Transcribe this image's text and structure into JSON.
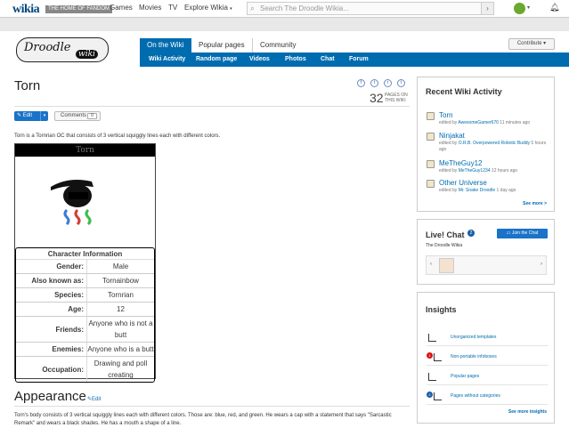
{
  "global": {
    "logo": "wikia",
    "tagline": "THE HOME OF FANDOM",
    "nav": [
      "Games",
      "Movies",
      "TV",
      "Explore Wikia"
    ],
    "search_placeholder": "Search The Droodle Wikia...",
    "avatar_color": "#6aa82e"
  },
  "wiki": {
    "wordmark_main": "Droodle",
    "wordmark_sub": "wiki",
    "tabs": [
      "On the Wiki",
      "Popular pages",
      "Community"
    ],
    "subnav": [
      "Wiki Activity",
      "Random page",
      "Videos",
      "Photos",
      "Chat",
      "Forum"
    ],
    "contribute": "Contribute",
    "accent": "#006cb0"
  },
  "article": {
    "title": "Torn",
    "social": [
      "f",
      "t",
      "r",
      "t"
    ],
    "pages_count": "32",
    "pages_label": "PAGES ON THIS WIKI",
    "edit_label": "Edit",
    "comments_label": "Comments",
    "comments_count": "0",
    "intro": "Torn is a Tornrian OC that consists of 3 vertical squiggly lines each with different colors.",
    "section_title": "Appearance",
    "section_edit": "Edit",
    "section_para": "Torn's body consists of 3 vertical squiggly lines each with different colors. Those are: blue, red, and green. He wears a cap with a statement that says \"Sarcastic Remark\" and wears a black shades. He has a mouth a shape of a line."
  },
  "infobox": {
    "title": "Torn",
    "header": "Character Information",
    "rows": [
      {
        "k": "Gender:",
        "v": "Male"
      },
      {
        "k": "Also known as:",
        "v": "Tornainbow"
      },
      {
        "k": "Species:",
        "v": "Tornrian"
      },
      {
        "k": "Age:",
        "v": "12"
      },
      {
        "k": "Friends:",
        "v": "Anyone who is not a butt"
      },
      {
        "k": "Enemies:",
        "v": "Anyone who is a butt"
      },
      {
        "k": "Occupation:",
        "v": "Drawing and poll creating"
      }
    ]
  },
  "rail": {
    "activity_title": "Recent Wiki Activity",
    "activity": [
      {
        "title": "Torn",
        "pre": "edited by ",
        "user": "AwesomeGamer670",
        "time": " 11 minutes ago"
      },
      {
        "title": "Ninjakat",
        "pre": "edited by ",
        "user": "O.R.B. Overpowered Robotic Buddy",
        "time": " 5 hours ago"
      },
      {
        "title": "MeTheGuy12",
        "pre": "edited by ",
        "user": "MeTheGuy1234",
        "time": " 12 hours ago"
      },
      {
        "title": "Other Universe",
        "pre": "edited by ",
        "user": "Mr. Snake Droodle",
        "time": " 1 day ago"
      }
    ],
    "activity_more": "See more >",
    "chat_title": "Live! Chat",
    "chat_count": "2",
    "chat_join": "Join the Chat",
    "chat_wiki": "The Droodle Wikia",
    "insights_title": "Insights",
    "insights": [
      {
        "label": "Unorganized templates",
        "badge": ""
      },
      {
        "label": "Non-portable infoboxes",
        "badge": "1"
      },
      {
        "label": "Popular pages",
        "badge": ""
      },
      {
        "label": "Pages without categories",
        "badge": "2"
      }
    ],
    "insights_more": "See more insights"
  }
}
